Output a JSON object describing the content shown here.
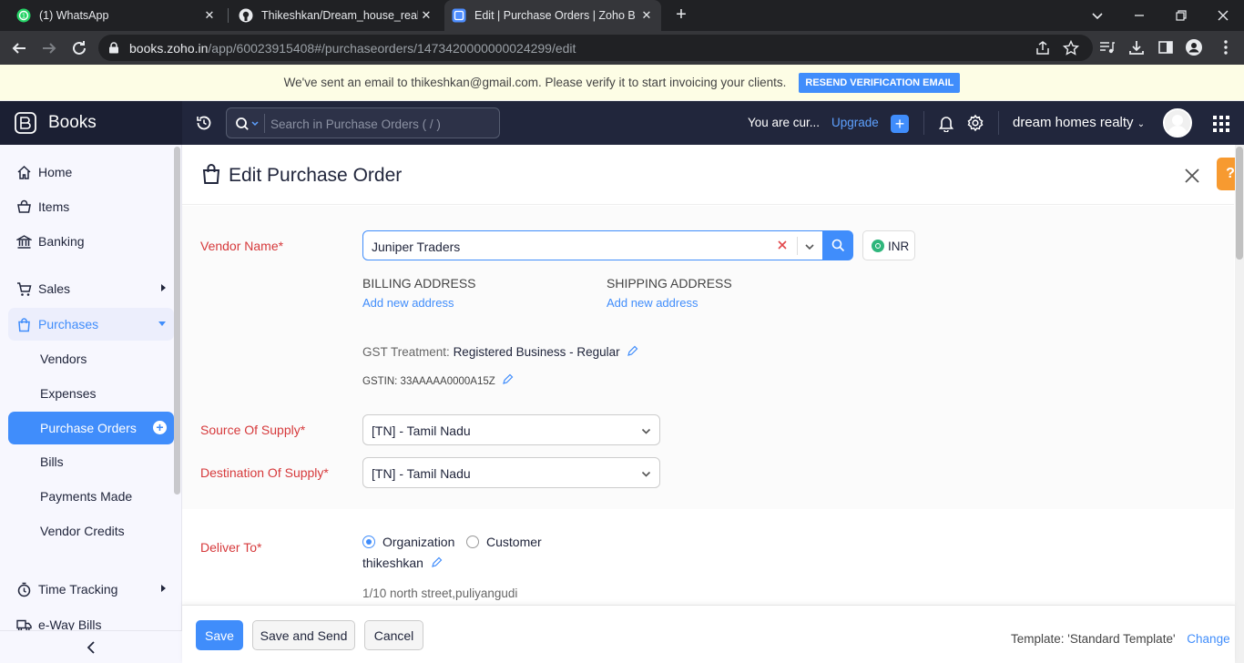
{
  "browser": {
    "tabs": [
      {
        "title": "(1) WhatsApp"
      },
      {
        "title": "Thikeshkan/Dream_house_realty"
      },
      {
        "title": "Edit | Purchase Orders | Zoho Bo"
      }
    ],
    "url_host": "books.zoho.in",
    "url_path": "/app/60023915408#/purchaseorders/1473420000000024299/edit"
  },
  "banner": {
    "text": "We've sent an email to thikeshkan@gmail.com. Please verify it to start invoicing your clients.",
    "button": "RESEND VERIFICATION EMAIL"
  },
  "header": {
    "brand": "Books",
    "search_placeholder": "Search in Purchase Orders ( / )",
    "trial_text": "You are cur...",
    "upgrade": "Upgrade",
    "org_name": "dream homes realty"
  },
  "sidebar": {
    "items": [
      {
        "label": "Home"
      },
      {
        "label": "Items"
      },
      {
        "label": "Banking"
      },
      {
        "label": "Sales"
      },
      {
        "label": "Purchases"
      },
      {
        "label": "Vendors"
      },
      {
        "label": "Expenses"
      },
      {
        "label": "Purchase Orders"
      },
      {
        "label": "Bills"
      },
      {
        "label": "Payments Made"
      },
      {
        "label": "Vendor Credits"
      },
      {
        "label": "Time Tracking"
      },
      {
        "label": "e-Way Bills"
      }
    ]
  },
  "form": {
    "title": "Edit Purchase Order",
    "vendor_label": "Vendor Name*",
    "vendor_value": "Juniper Traders",
    "currency": "INR",
    "billing_heading": "BILLING ADDRESS",
    "billing_link": "Add new address",
    "shipping_heading": "SHIPPING ADDRESS",
    "shipping_link": "Add new address",
    "gst_label": "GST Treatment:",
    "gst_value": "Registered Business - Regular",
    "gstin_label": "GSTIN:",
    "gstin_value": "33AAAAA0000A15Z",
    "source_label": "Source Of Supply*",
    "source_value": "[TN] - Tamil Nadu",
    "destination_label": "Destination Of Supply*",
    "destination_value": "[TN] - Tamil Nadu",
    "deliver_label": "Deliver To*",
    "radio_org": "Organization",
    "radio_customer": "Customer",
    "deliver_name": "thikeshkan",
    "deliver_address": "1/10 north street,puliyangudi"
  },
  "footer": {
    "save": "Save",
    "save_send": "Save and Send",
    "cancel": "Cancel",
    "template_label": "Template:",
    "template_value": "'Standard Template'",
    "change": "Change"
  },
  "colors": {
    "accent": "#408dfb",
    "required_label": "#d6393b",
    "header_bg": "#21263c",
    "help_button": "#f79a30"
  }
}
